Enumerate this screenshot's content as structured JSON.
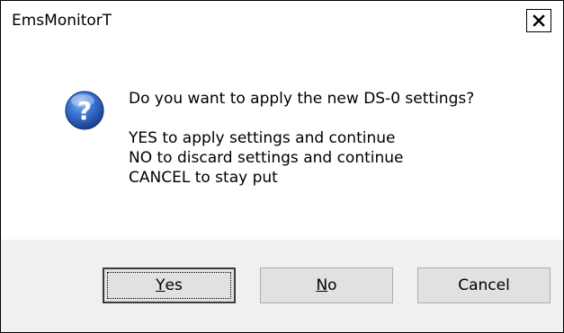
{
  "window": {
    "title": "EmsMonitorT",
    "close_glyph": "×",
    "close_icon": "close-icon"
  },
  "message": {
    "icon": "question-icon",
    "question": "Do you want to apply the new DS-0 settings?",
    "lines": [
      "YES to apply settings and continue",
      "NO to discard settings and continue",
      "CANCEL to stay put"
    ]
  },
  "buttons": {
    "yes": {
      "mnemonic": "Y",
      "rest": "es"
    },
    "no": {
      "mnemonic": "N",
      "rest": "o"
    },
    "cancel": {
      "label": "Cancel"
    }
  },
  "colors": {
    "button_area_bg": "#f0f0f0",
    "button_bg": "#e1e1e1",
    "icon_blue": "#2a5db8"
  }
}
